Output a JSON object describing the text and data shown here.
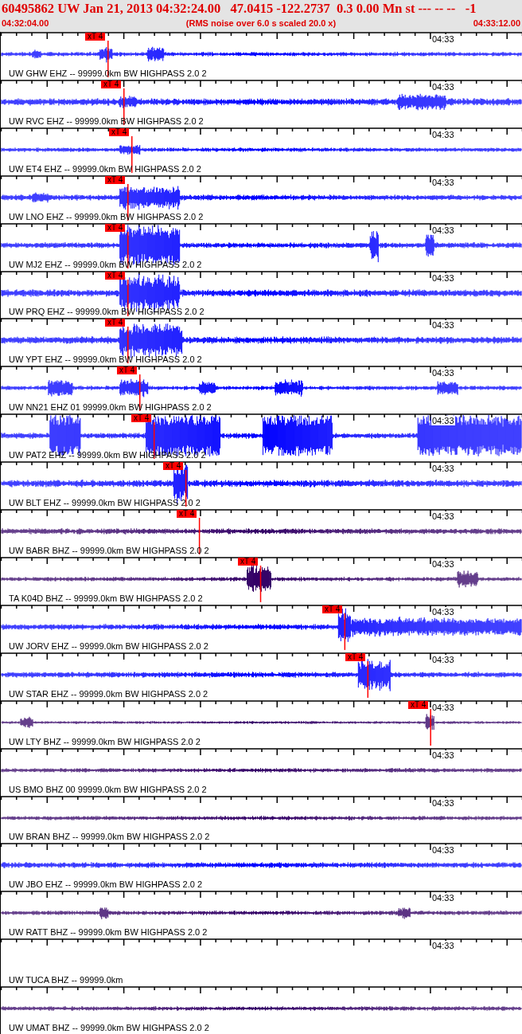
{
  "header": {
    "title": "60495862 UW Jan 21, 2013 04:32:24.00   47.0415 -122.2737  0.3 0.00 Mn st --- -- --   -1",
    "start_time": "04:32:04.00",
    "note": "(RMS noise over 6.0 s scaled 20.0 x)",
    "end_time": "04:33:12.00"
  },
  "traces": [
    {
      "kind": "waveform",
      "label": "UW GHW EHZ -- 99999.0km BW HIGHPASS 2.0 2",
      "tick_label": "04:33",
      "pick": "xT 4",
      "color": "#0000ff"
    },
    {
      "kind": "waveform",
      "label": "UW RVC EHZ -- 99999.0km BW HIGHPASS 2.0 2",
      "tick_label": "04:33",
      "pick": "xT 4",
      "color": "#0000ff"
    },
    {
      "kind": "waveform",
      "label": "UW ET4 EHZ -- 99999.0km BW HIGHPASS 2.0 2",
      "tick_label": "04:33",
      "pick": "xT 4",
      "color": "#0000ff"
    },
    {
      "kind": "waveform",
      "label": "UW LNO EHZ -- 99999.0km BW HIGHPASS 2.0 2",
      "tick_label": "04:33",
      "pick": "xT 4",
      "color": "#0000ff"
    },
    {
      "kind": "waveform",
      "label": "UW MJ2 EHZ -- 99999.0km BW HIGHPASS 2.0 2",
      "tick_label": "04:33",
      "pick": "xT 4",
      "color": "#0000ff"
    },
    {
      "kind": "waveform",
      "label": "UW PRQ EHZ -- 99999.0km BW HIGHPASS 2.0 2",
      "tick_label": "04:33",
      "pick": "xT 4",
      "color": "#0000ff"
    },
    {
      "kind": "waveform",
      "label": "UW YPT EHZ -- 99999.0km BW HIGHPASS 2.0 2",
      "tick_label": "04:33",
      "pick": "xT 4",
      "color": "#0000ff"
    },
    {
      "kind": "waveform",
      "label": "UW NN21 EHZ 01 99999.0km BW HIGHPASS 2.0 2",
      "tick_label": "04:33",
      "pick": "xT 4",
      "color": "#0000ff"
    },
    {
      "kind": "waveform",
      "label": "UW PAT2 EHZ -- 99999.0km BW HIGHPASS 2.0 2",
      "tick_label": "04:33",
      "pick": "xT 4",
      "color": "#0000ff"
    },
    {
      "kind": "waveform",
      "label": "UW BLT EHZ -- 99999.0km BW HIGHPASS 2.0 2",
      "tick_label": "04:33",
      "pick": "xT 4",
      "color": "#0000ff"
    },
    {
      "kind": "waveform",
      "label": "UW BABR BHZ -- 99999.0km BW HIGHPASS 2.0 2",
      "tick_label": "04:33",
      "pick": "xT 4",
      "color": "#330066"
    },
    {
      "kind": "waveform",
      "label": "TA K04D BHZ -- 99999.0km BW HIGHPASS 2.0 2",
      "tick_label": "04:33",
      "pick": "xT 4",
      "color": "#330066"
    },
    {
      "kind": "waveform",
      "label": "UW JORV EHZ -- 99999.0km BW HIGHPASS 2.0 2",
      "tick_label": "04:33",
      "pick": "xT 4",
      "color": "#0000ff"
    },
    {
      "kind": "waveform",
      "label": "UW STAR EHZ -- 99999.0km BW HIGHPASS 2.0 2",
      "tick_label": "04:33",
      "pick": "xT 4",
      "color": "#0000ff"
    },
    {
      "kind": "waveform",
      "label": "UW LTY BHZ -- 99999.0km BW HIGHPASS 2.0 2",
      "tick_label": "04:33",
      "pick": "xT 4",
      "color": "#330066"
    },
    {
      "kind": "waveform",
      "label": "US BMO BHZ 00 99999.0km BW HIGHPASS 2.0 2",
      "tick_label": "04:33",
      "color": "#330066"
    },
    {
      "kind": "waveform",
      "label": "UW BRAN BHZ -- 99999.0km BW HIGHPASS 2.0 2",
      "tick_label": "04:33",
      "color": "#330066"
    },
    {
      "kind": "waveform",
      "label": "UW JBO EHZ -- 99999.0km BW HIGHPASS 2.0 2",
      "tick_label": "04:33",
      "color": "#0000ff"
    },
    {
      "kind": "waveform",
      "label": "UW RATT BHZ -- 99999.0km BW HIGHPASS 2.0 2",
      "tick_label": "04:33",
      "color": "#330066"
    },
    {
      "kind": "blank",
      "label": "UW TUCA BHZ -- 99999.0km",
      "tick_label": "04:33"
    },
    {
      "kind": "waveform",
      "label": "UW UMAT BHZ -- 99999.0km BW HIGHPASS 2.0 2",
      "color": "#330066"
    }
  ]
}
